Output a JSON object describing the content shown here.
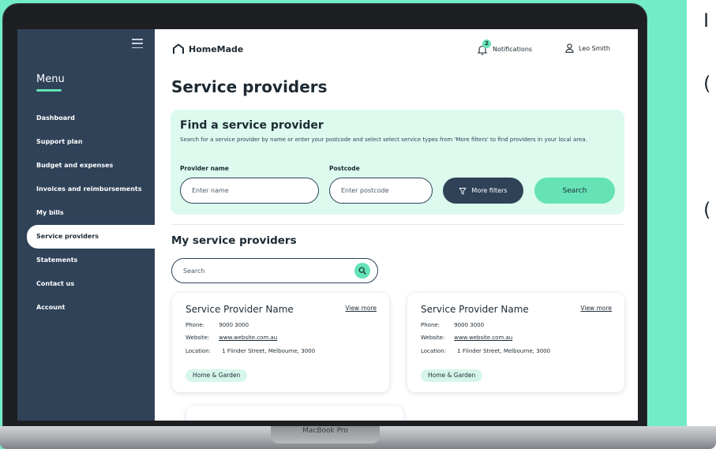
{
  "device": {
    "label": "MacBook Pro"
  },
  "colors": {
    "background": "#72ecc6",
    "sidebar": "#2f4258",
    "accent": "#65e3b7",
    "panel": "#dcfaee",
    "text": "#1d2a33"
  },
  "sidebar": {
    "menu_title": "Menu",
    "items": [
      {
        "label": "Dashboard",
        "active": false
      },
      {
        "label": "Support plan",
        "active": false
      },
      {
        "label": "Budget and expenses",
        "active": false
      },
      {
        "label": "Invoices and reimbursements",
        "active": false
      },
      {
        "label": "My bills",
        "active": false
      },
      {
        "label": "Service providers",
        "active": true
      },
      {
        "label": "Statements",
        "active": false
      },
      {
        "label": "Contact us",
        "active": false
      },
      {
        "label": "Account",
        "active": false
      }
    ]
  },
  "header": {
    "brand": "HomeMade",
    "notifications_label": "Notifications",
    "notifications_count": "2",
    "user_name": "Leo Smith"
  },
  "page": {
    "title": "Service providers"
  },
  "find_panel": {
    "title": "Find a service provider",
    "description": "Search for a service provider by name or enter your postcode and select select service types from 'More filters' to find providers in your local area.",
    "provider_name_label": "Provider name",
    "provider_name_placeholder": "Enter name",
    "postcode_label": "Postcode",
    "postcode_placeholder": "Enter postcode",
    "more_filters_label": "More filters",
    "search_label": "Search"
  },
  "my_providers": {
    "title": "My service providers",
    "search_placeholder": "Search",
    "cards": [
      {
        "name": "Service Provider Name",
        "view_more": "View more",
        "phone_label": "Phone:",
        "phone": "9000 3000",
        "website_label": "Website:",
        "website": "www.website.com.au",
        "location_label": "Location:",
        "location": "1 Flinder Street, Melbourne, 3000",
        "tag": "Home & Garden"
      },
      {
        "name": "Service Provider Name",
        "view_more": "View more",
        "phone_label": "Phone:",
        "phone": "9000 3000",
        "website_label": "Website:",
        "website": "www.website.com.au",
        "location_label": "Location:",
        "location": "1 Flinder Street, Melbourne, 3000",
        "tag": "Home & Garden"
      }
    ]
  }
}
